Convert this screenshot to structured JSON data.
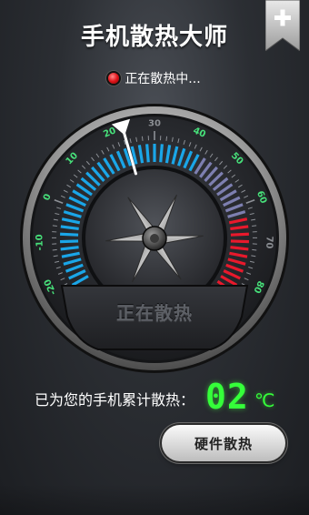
{
  "header": {
    "title": "手机散热大师",
    "add_button_symbol": "+"
  },
  "status": {
    "text": "正在散热中...",
    "indicator_color": "#e0141a"
  },
  "gauge": {
    "center_label": "正在散热",
    "needle_value": 23,
    "range": [
      -30,
      90
    ],
    "tick_labels": [
      "-20",
      "-10",
      "0",
      "10",
      "20",
      "30",
      "40",
      "50",
      "60",
      "70",
      "80"
    ],
    "colors": {
      "cool": "#1aa6e8",
      "warm": "#7d7fb0",
      "hot": "#e8192c",
      "tick_label_green": "#47e07a",
      "tick_label_gray": "#8a8d92"
    }
  },
  "total": {
    "label": "已为您的手机累计散热：",
    "value": "02",
    "unit": "℃"
  },
  "actions": {
    "hardware_cooling": "硬件散热"
  }
}
